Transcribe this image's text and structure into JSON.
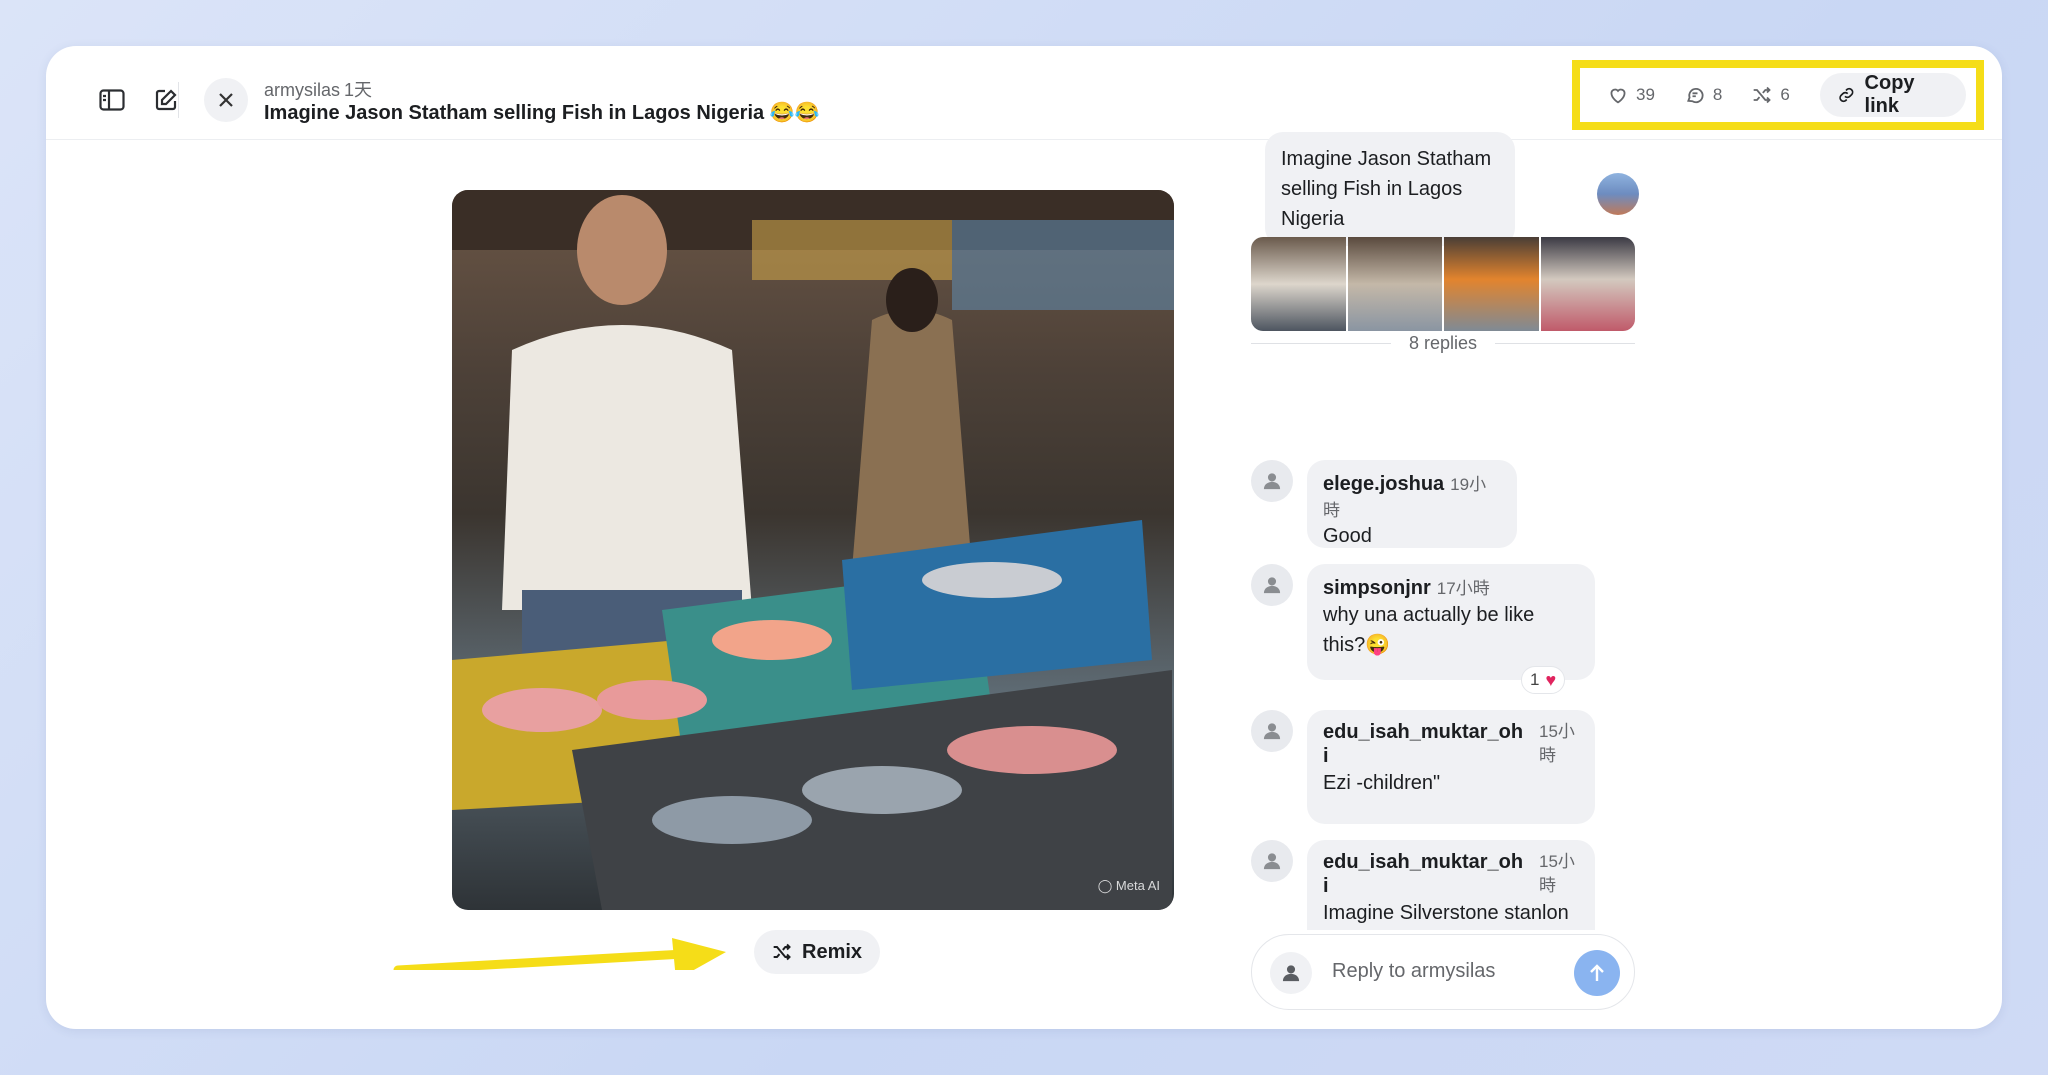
{
  "post": {
    "username": "armysilas",
    "posted_ago": "1天",
    "title": "Imagine Jason Statham selling Fish in Lagos Nigeria 😂😂"
  },
  "actions": {
    "likes": "39",
    "comments": "8",
    "remixes": "6",
    "copy_link": "Copy link"
  },
  "image": {
    "watermark": "Meta AI"
  },
  "remix_label": "Remix",
  "prompt": {
    "text": "Imagine Jason Statham selling Fish in Lagos Nigeria"
  },
  "replies_label": "8 replies",
  "comments": [
    {
      "user": "elege.joshua",
      "time": "19小時",
      "text": "Good"
    },
    {
      "user": "simpsonjnr",
      "time": "17小時",
      "text": "why una actually be like this?😜",
      "reaction_count": "1"
    },
    {
      "user": "edu_isah_muktar_oh i",
      "time": "15小 時",
      "text": "Ezi -children\""
    },
    {
      "user": "edu_isah_muktar_oh i",
      "time": "15小 時",
      "text": "Imagine Silverstone stanlon"
    }
  ],
  "reply_placeholder": "Reply to armysilas",
  "colors": {
    "highlight": "#f5dd18",
    "send_button": "#8ab4f0",
    "heart": "#e0245e"
  }
}
